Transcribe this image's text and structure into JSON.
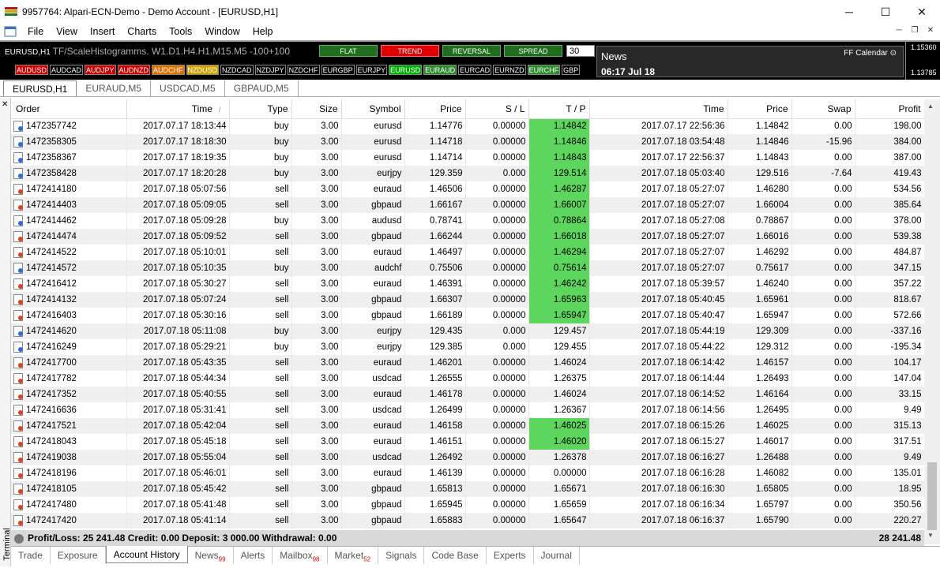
{
  "window": {
    "title": "9957764: Alpari-ECN-Demo - Demo Account - [EURUSD,H1]",
    "min": "─",
    "max": "☐",
    "close": "✕"
  },
  "menu": [
    "File",
    "View",
    "Insert",
    "Charts",
    "Tools",
    "Window",
    "Help"
  ],
  "chart": {
    "symbol": "EURUSD,H1",
    "indicator": "TF/ScaleHistogramms. W1.D1.H4.H1.M15.M5 -100+100",
    "modes": [
      {
        "label": "FLAT",
        "active": false
      },
      {
        "label": "TREND",
        "active": true
      },
      {
        "label": "REVERSAL",
        "active": false
      },
      {
        "label": "SPREAD",
        "active": false
      }
    ],
    "mode_value": "30",
    "pairs": [
      {
        "label": "AUDUSD",
        "color": "red"
      },
      {
        "label": "AUDCAD",
        "color": "black"
      },
      {
        "label": "AUDJPY",
        "color": "red"
      },
      {
        "label": "AUDNZD",
        "color": "red"
      },
      {
        "label": "AUDCHF",
        "color": "orange"
      },
      {
        "label": "NZDUSD",
        "color": "gold"
      },
      {
        "label": "NZDCAD",
        "color": "black"
      },
      {
        "label": "NZDJPY",
        "color": "black"
      },
      {
        "label": "NZDCHF",
        "color": "black"
      },
      {
        "label": "EURGBP",
        "color": "black"
      },
      {
        "label": "EURJPY",
        "color": "black"
      },
      {
        "label": "EURUSD",
        "color": "green"
      },
      {
        "label": "EURAUD",
        "color": "dkgreen"
      },
      {
        "label": "EURCAD",
        "color": "black"
      },
      {
        "label": "EURNZD",
        "color": "black"
      },
      {
        "label": "EURCHF",
        "color": "dkgreen"
      },
      {
        "label": "GBP",
        "color": "black"
      }
    ],
    "news_title": "News",
    "news_time": "06:17 Jul 18",
    "ff_calendar": "FF Calendar",
    "price_high": "1.15360",
    "price_low": "1.13785"
  },
  "chart_tabs": [
    {
      "label": "EURUSD,H1",
      "active": true
    },
    {
      "label": "EURAUD,M5",
      "active": false
    },
    {
      "label": "USDCAD,M5",
      "active": false
    },
    {
      "label": "GBPAUD,M5",
      "active": false
    }
  ],
  "table": {
    "columns": [
      "Order",
      "Time",
      "Type",
      "Size",
      "Symbol",
      "Price",
      "S / L",
      "T / P",
      "Time",
      "Price",
      "Swap",
      "Profit"
    ],
    "sort_indicator": "/",
    "rows": [
      {
        "order": "1472357742",
        "time": "2017.07.17 18:13:44",
        "type": "buy",
        "size": "3.00",
        "symbol": "eurusd",
        "price": "1.14776",
        "sl": "0.00000",
        "tp": "1.14842",
        "tp_hit": true,
        "close_time": "2017.07.17 22:56:36",
        "close_price": "1.14842",
        "swap": "0.00",
        "profit": "198.00"
      },
      {
        "order": "1472358305",
        "time": "2017.07.17 18:18:30",
        "type": "buy",
        "size": "3.00",
        "symbol": "eurusd",
        "price": "1.14718",
        "sl": "0.00000",
        "tp": "1.14846",
        "tp_hit": true,
        "close_time": "2017.07.18 03:54:48",
        "close_price": "1.14846",
        "swap": "-15.96",
        "profit": "384.00"
      },
      {
        "order": "1472358367",
        "time": "2017.07.17 18:19:35",
        "type": "buy",
        "size": "3.00",
        "symbol": "eurusd",
        "price": "1.14714",
        "sl": "0.00000",
        "tp": "1.14843",
        "tp_hit": true,
        "close_time": "2017.07.17 22:56:37",
        "close_price": "1.14843",
        "swap": "0.00",
        "profit": "387.00"
      },
      {
        "order": "1472358428",
        "time": "2017.07.17 18:20:28",
        "type": "buy",
        "size": "3.00",
        "symbol": "eurjpy",
        "price": "129.359",
        "sl": "0.000",
        "tp": "129.514",
        "tp_hit": true,
        "close_time": "2017.07.18 05:03:40",
        "close_price": "129.516",
        "swap": "-7.64",
        "profit": "419.43"
      },
      {
        "order": "1472414180",
        "time": "2017.07.18 05:07:56",
        "type": "sell",
        "size": "3.00",
        "symbol": "euraud",
        "price": "1.46506",
        "sl": "0.00000",
        "tp": "1.46287",
        "tp_hit": true,
        "close_time": "2017.07.18 05:27:07",
        "close_price": "1.46280",
        "swap": "0.00",
        "profit": "534.56"
      },
      {
        "order": "1472414403",
        "time": "2017.07.18 05:09:05",
        "type": "sell",
        "size": "3.00",
        "symbol": "gbpaud",
        "price": "1.66167",
        "sl": "0.00000",
        "tp": "1.66007",
        "tp_hit": true,
        "close_time": "2017.07.18 05:27:07",
        "close_price": "1.66004",
        "swap": "0.00",
        "profit": "385.64"
      },
      {
        "order": "1472414462",
        "time": "2017.07.18 05:09:28",
        "type": "buy",
        "size": "3.00",
        "symbol": "audusd",
        "price": "0.78741",
        "sl": "0.00000",
        "tp": "0.78864",
        "tp_hit": true,
        "close_time": "2017.07.18 05:27:08",
        "close_price": "0.78867",
        "swap": "0.00",
        "profit": "378.00"
      },
      {
        "order": "1472414474",
        "time": "2017.07.18 05:09:52",
        "type": "sell",
        "size": "3.00",
        "symbol": "gbpaud",
        "price": "1.66244",
        "sl": "0.00000",
        "tp": "1.66018",
        "tp_hit": true,
        "close_time": "2017.07.18 05:27:07",
        "close_price": "1.66016",
        "swap": "0.00",
        "profit": "539.38"
      },
      {
        "order": "1472414522",
        "time": "2017.07.18 05:10:01",
        "type": "sell",
        "size": "3.00",
        "symbol": "euraud",
        "price": "1.46497",
        "sl": "0.00000",
        "tp": "1.46294",
        "tp_hit": true,
        "close_time": "2017.07.18 05:27:07",
        "close_price": "1.46292",
        "swap": "0.00",
        "profit": "484.87"
      },
      {
        "order": "1472414572",
        "time": "2017.07.18 05:10:35",
        "type": "buy",
        "size": "3.00",
        "symbol": "audchf",
        "price": "0.75506",
        "sl": "0.00000",
        "tp": "0.75614",
        "tp_hit": true,
        "close_time": "2017.07.18 05:27:07",
        "close_price": "0.75617",
        "swap": "0.00",
        "profit": "347.15"
      },
      {
        "order": "1472416412",
        "time": "2017.07.18 05:30:27",
        "type": "sell",
        "size": "3.00",
        "symbol": "euraud",
        "price": "1.46391",
        "sl": "0.00000",
        "tp": "1.46242",
        "tp_hit": true,
        "close_time": "2017.07.18 05:39:57",
        "close_price": "1.46240",
        "swap": "0.00",
        "profit": "357.22"
      },
      {
        "order": "1472414132",
        "time": "2017.07.18 05:07:24",
        "type": "sell",
        "size": "3.00",
        "symbol": "gbpaud",
        "price": "1.66307",
        "sl": "0.00000",
        "tp": "1.65963",
        "tp_hit": true,
        "close_time": "2017.07.18 05:40:45",
        "close_price": "1.65961",
        "swap": "0.00",
        "profit": "818.67"
      },
      {
        "order": "1472416403",
        "time": "2017.07.18 05:30:16",
        "type": "sell",
        "size": "3.00",
        "symbol": "gbpaud",
        "price": "1.66189",
        "sl": "0.00000",
        "tp": "1.65947",
        "tp_hit": true,
        "close_time": "2017.07.18 05:40:47",
        "close_price": "1.65947",
        "swap": "0.00",
        "profit": "572.66"
      },
      {
        "order": "1472414620",
        "time": "2017.07.18 05:11:08",
        "type": "buy",
        "size": "3.00",
        "symbol": "eurjpy",
        "price": "129.435",
        "sl": "0.000",
        "tp": "129.457",
        "tp_hit": false,
        "close_time": "2017.07.18 05:44:19",
        "close_price": "129.309",
        "swap": "0.00",
        "profit": "-337.16"
      },
      {
        "order": "1472416249",
        "time": "2017.07.18 05:29:21",
        "type": "buy",
        "size": "3.00",
        "symbol": "eurjpy",
        "price": "129.385",
        "sl": "0.000",
        "tp": "129.455",
        "tp_hit": false,
        "close_time": "2017.07.18 05:44:22",
        "close_price": "129.312",
        "swap": "0.00",
        "profit": "-195.34"
      },
      {
        "order": "1472417700",
        "time": "2017.07.18 05:43:35",
        "type": "sell",
        "size": "3.00",
        "symbol": "euraud",
        "price": "1.46201",
        "sl": "0.00000",
        "tp": "1.46024",
        "tp_hit": false,
        "close_time": "2017.07.18 06:14:42",
        "close_price": "1.46157",
        "swap": "0.00",
        "profit": "104.17"
      },
      {
        "order": "1472417782",
        "time": "2017.07.18 05:44:34",
        "type": "sell",
        "size": "3.00",
        "symbol": "usdcad",
        "price": "1.26555",
        "sl": "0.00000",
        "tp": "1.26375",
        "tp_hit": false,
        "close_time": "2017.07.18 06:14:44",
        "close_price": "1.26493",
        "swap": "0.00",
        "profit": "147.04"
      },
      {
        "order": "1472417352",
        "time": "2017.07.18 05:40:55",
        "type": "sell",
        "size": "3.00",
        "symbol": "euraud",
        "price": "1.46178",
        "sl": "0.00000",
        "tp": "1.46024",
        "tp_hit": false,
        "close_time": "2017.07.18 06:14:52",
        "close_price": "1.46164",
        "swap": "0.00",
        "profit": "33.15"
      },
      {
        "order": "1472416636",
        "time": "2017.07.18 05:31:41",
        "type": "sell",
        "size": "3.00",
        "symbol": "usdcad",
        "price": "1.26499",
        "sl": "0.00000",
        "tp": "1.26367",
        "tp_hit": false,
        "close_time": "2017.07.18 06:14:56",
        "close_price": "1.26495",
        "swap": "0.00",
        "profit": "9.49"
      },
      {
        "order": "1472417521",
        "time": "2017.07.18 05:42:04",
        "type": "sell",
        "size": "3.00",
        "symbol": "euraud",
        "price": "1.46158",
        "sl": "0.00000",
        "tp": "1.46025",
        "tp_hit": true,
        "close_time": "2017.07.18 06:15:26",
        "close_price": "1.46025",
        "swap": "0.00",
        "profit": "315.13"
      },
      {
        "order": "1472418043",
        "time": "2017.07.18 05:45:18",
        "type": "sell",
        "size": "3.00",
        "symbol": "euraud",
        "price": "1.46151",
        "sl": "0.00000",
        "tp": "1.46020",
        "tp_hit": true,
        "close_time": "2017.07.18 06:15:27",
        "close_price": "1.46017",
        "swap": "0.00",
        "profit": "317.51"
      },
      {
        "order": "1472419038",
        "time": "2017.07.18 05:55:04",
        "type": "sell",
        "size": "3.00",
        "symbol": "usdcad",
        "price": "1.26492",
        "sl": "0.00000",
        "tp": "1.26378",
        "tp_hit": false,
        "close_time": "2017.07.18 06:16:27",
        "close_price": "1.26488",
        "swap": "0.00",
        "profit": "9.49"
      },
      {
        "order": "1472418196",
        "time": "2017.07.18 05:46:01",
        "type": "sell",
        "size": "3.00",
        "symbol": "euraud",
        "price": "1.46139",
        "sl": "0.00000",
        "tp": "0.00000",
        "tp_hit": false,
        "close_time": "2017.07.18 06:16:28",
        "close_price": "1.46082",
        "swap": "0.00",
        "profit": "135.01"
      },
      {
        "order": "1472418105",
        "time": "2017.07.18 05:45:42",
        "type": "sell",
        "size": "3.00",
        "symbol": "gbpaud",
        "price": "1.65813",
        "sl": "0.00000",
        "tp": "1.65671",
        "tp_hit": false,
        "close_time": "2017.07.18 06:16:30",
        "close_price": "1.65805",
        "swap": "0.00",
        "profit": "18.95"
      },
      {
        "order": "1472417480",
        "time": "2017.07.18 05:41:48",
        "type": "sell",
        "size": "3.00",
        "symbol": "gbpaud",
        "price": "1.65945",
        "sl": "0.00000",
        "tp": "1.65659",
        "tp_hit": false,
        "close_time": "2017.07.18 06:16:34",
        "close_price": "1.65797",
        "swap": "0.00",
        "profit": "350.56"
      },
      {
        "order": "1472417420",
        "time": "2017.07.18 05:41:14",
        "type": "sell",
        "size": "3.00",
        "symbol": "gbpaud",
        "price": "1.65883",
        "sl": "0.00000",
        "tp": "1.65647",
        "tp_hit": false,
        "close_time": "2017.07.18 06:16:37",
        "close_price": "1.65790",
        "swap": "0.00",
        "profit": "220.27"
      }
    ]
  },
  "summary": {
    "left": "Profit/Loss: 25 241.48  Credit: 0.00  Deposit: 3 000.00  Withdrawal: 0.00",
    "right": "28 241.48"
  },
  "terminal_label": "Terminal",
  "bottom_tabs": [
    {
      "label": "Trade",
      "badge": "",
      "active": false
    },
    {
      "label": "Exposure",
      "badge": "",
      "active": false
    },
    {
      "label": "Account History",
      "badge": "",
      "active": true
    },
    {
      "label": "News",
      "badge": "99",
      "active": false
    },
    {
      "label": "Alerts",
      "badge": "",
      "active": false
    },
    {
      "label": "Mailbox",
      "badge": "98",
      "active": false
    },
    {
      "label": "Market",
      "badge": "52",
      "active": false
    },
    {
      "label": "Signals",
      "badge": "",
      "active": false
    },
    {
      "label": "Code Base",
      "badge": "",
      "active": false
    },
    {
      "label": "Experts",
      "badge": "",
      "active": false
    },
    {
      "label": "Journal",
      "badge": "",
      "active": false
    }
  ],
  "colors": {
    "tp_hit": "#5cd65c",
    "mode_active": "#e00000",
    "mode_inactive": "#1e6e1e"
  }
}
